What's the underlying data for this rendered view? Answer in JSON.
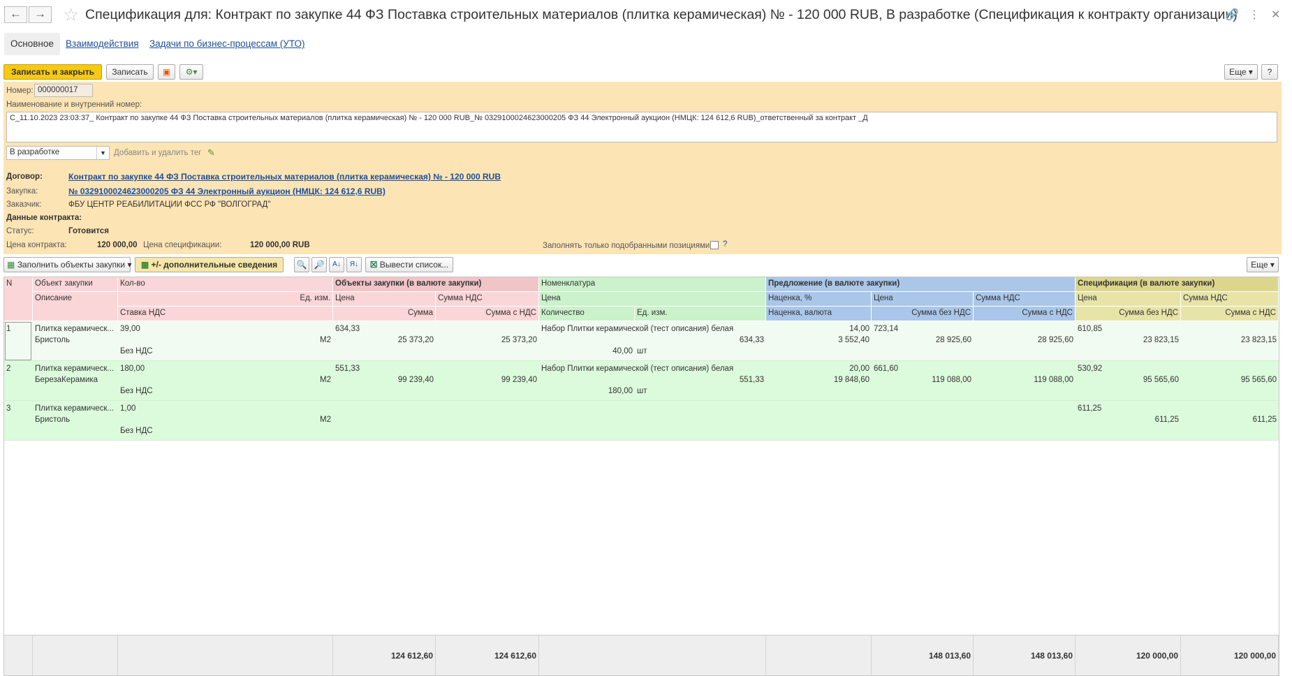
{
  "title": "Спецификация для: Контракт по закупке 44 ФЗ Поставка строительных материалов (плитка керамическая) № - 120 000 RUB, В разработке (Спецификация к контракту организации)",
  "tabs": [
    "Основное",
    "Взаимодействия",
    "Задачи по бизнес-процессам (УТО)"
  ],
  "toolbar": {
    "save_close": "Записать и закрыть",
    "save": "Записать",
    "more": "Еще",
    "help": "?"
  },
  "form": {
    "number_label": "Номер:",
    "number": "000000017",
    "name_label": "Наименование и внутренний номер:",
    "name": "С_11.10.2023 23:03:37_ Контракт по закупке 44 ФЗ Поставка строительных материалов (плитка керамическая) № - 120 000 RUB_№ 0329100024623000205 ФЗ 44 Электронный аукцион (НМЦК: 124 612,6 RUB)_ответственный за контракт _Д",
    "status_select": "В разработке",
    "tag_link": "Добавить и удалить тег",
    "contract_label": "Договор:",
    "contract": "Контракт по закупке 44 ФЗ Поставка строительных материалов (плитка керамическая) № - 120 000 RUB",
    "purchase_label": "Закупка:",
    "purchase": "№ 0329100024623000205 ФЗ 44 Электронный аукцион (НМЦК: 124 612,6 RUB)",
    "customer_label": "Заказчик:",
    "customer": "ФБУ ЦЕНТР РЕАБИЛИТАЦИИ ФСС РФ \"ВОЛГОГРАД\"",
    "contract_data_label": "Данные контракта:",
    "status_label": "Статус:",
    "status": "Готовится",
    "price_label": "Цена контракта:",
    "price": "120 000,00",
    "spec_price_label": "Цена спецификации:",
    "spec_price": "120 000,00 RUB",
    "fill_only_label": "Заполнять только подобранными позициями:",
    "help_mark": "?"
  },
  "table_toolbar": {
    "fill": "Заполнить объекты закупки",
    "extra": "+/- дополнительные сведения",
    "list": "Вывести список...",
    "more": "Еще"
  },
  "headers": {
    "n": "N",
    "object": "Объект закупки",
    "desc": "Описание",
    "qty": "Кол-во",
    "unit": "Ед. изм.",
    "vat_rate": "Ставка НДС",
    "grp_obj": "Объекты закупки (в валюте закупки)",
    "price": "Цена",
    "vat_sum": "Сумма НДС",
    "sum": "Сумма",
    "sum_vat": "Сумма с НДС",
    "nomen": "Номенклатура",
    "n_price": "Цена",
    "n_qty": "Количество",
    "n_unit": "Ед. изм.",
    "grp_offer": "Предложение (в валюте закупки)",
    "markup_pct": "Наценка, %",
    "markup_val": "Наценка, валюта",
    "o_price": "Цена",
    "o_sum_novat": "Сумма без НДС",
    "o_vat": "Сумма НДС",
    "o_sum_vat": "Сумма с НДС",
    "grp_spec": "Спецификация (в валюте закупки)",
    "s_price": "Цена",
    "s_vat": "Сумма НДС",
    "s_sum_novat": "Сумма без НДС",
    "s_sum_vat": "Сумма с НДС"
  },
  "rows": [
    {
      "n": "1",
      "object": "Плитка керамическ...",
      "desc": "Бристоль",
      "qty": "39,00",
      "unit": "М2",
      "vat": "Без НДС",
      "price": "634,33",
      "sum": "25 373,20",
      "sum_vat": "25 373,20",
      "nomen": "Набор Плитки керамической (тест описания) белая",
      "n_price": "634,33",
      "n_qty": "40,00",
      "n_unit": "шт",
      "markup_pct": "14,00",
      "markup_val": "3 552,40",
      "o_price": "723,14",
      "o_sum_novat": "28 925,60",
      "o_sum_vat": "28 925,60",
      "s_price": "610,85",
      "s_sum_novat": "23 823,15",
      "s_sum_vat": "23 823,15"
    },
    {
      "n": "2",
      "object": "Плитка керамическ...",
      "desc": "БерезаКерамика",
      "qty": "180,00",
      "unit": "М2",
      "vat": "Без НДС",
      "price": "551,33",
      "sum": "99 239,40",
      "sum_vat": "99 239,40",
      "nomen": "Набор Плитки керамической (тест описания) белая",
      "n_price": "551,33",
      "n_qty": "180,00",
      "n_unit": "шт",
      "markup_pct": "20,00",
      "markup_val": "19 848,60",
      "o_price": "661,60",
      "o_sum_novat": "119 088,00",
      "o_sum_vat": "119 088,00",
      "s_price": "530,92",
      "s_sum_novat": "95 565,60",
      "s_sum_vat": "95 565,60"
    },
    {
      "n": "3",
      "object": "Плитка керамическ...",
      "desc": "Бристоль",
      "qty": "1,00",
      "unit": "М2",
      "vat": "Без НДС",
      "price": "",
      "sum": "",
      "sum_vat": "",
      "nomen": "",
      "n_price": "",
      "n_qty": "",
      "n_unit": "",
      "markup_pct": "",
      "markup_val": "",
      "o_price": "",
      "o_sum_novat": "",
      "o_sum_vat": "",
      "s_price": "611,25",
      "s_sum_novat": "611,25",
      "s_sum_vat": "611,25"
    }
  ],
  "totals": {
    "sum": "124 612,60",
    "sum_vat": "124 612,60",
    "o_sum_novat": "148 013,60",
    "o_sum_vat": "148 013,60",
    "s_sum_novat": "120 000,00",
    "s_sum_vat": "120 000,00"
  }
}
